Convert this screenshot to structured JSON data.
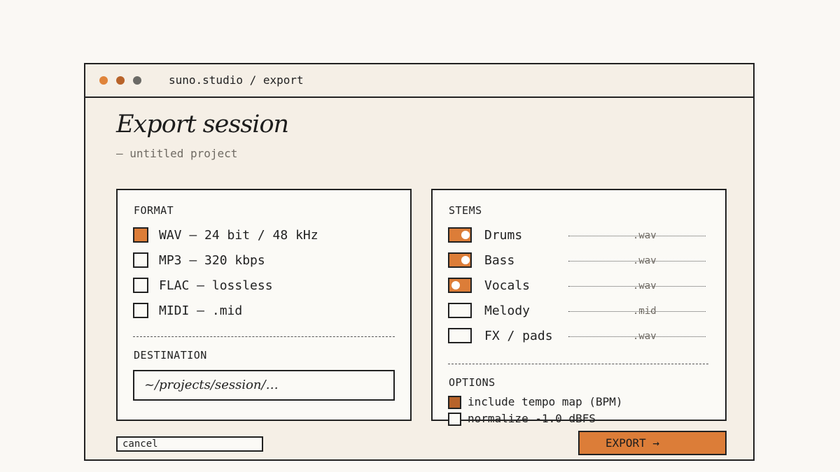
{
  "window": {
    "title": "suno.studio / export"
  },
  "header": {
    "title": "Export session",
    "subtitle": "— untitled project"
  },
  "format": {
    "label": "FORMAT",
    "options": [
      {
        "label": "WAV — 24 bit / 48 kHz",
        "checked": true
      },
      {
        "label": "MP3 — 320 kbps",
        "checked": false
      },
      {
        "label": "FLAC — lossless",
        "checked": false
      },
      {
        "label": "MIDI — .mid",
        "checked": false
      }
    ]
  },
  "destination": {
    "label": "DESTINATION",
    "value": "~/projects/session/…"
  },
  "stems": {
    "label": "STEMS",
    "items": [
      {
        "name": "Drums",
        "ext": ".wav",
        "on": true,
        "knob": "right"
      },
      {
        "name": "Bass",
        "ext": ".wav",
        "on": true,
        "knob": "right"
      },
      {
        "name": "Vocals",
        "ext": ".wav",
        "on": true,
        "knob": "left"
      },
      {
        "name": "Melody",
        "ext": ".mid",
        "on": false,
        "knob": "none"
      },
      {
        "name": "FX / pads",
        "ext": ".wav",
        "on": false,
        "knob": "none"
      }
    ]
  },
  "options": {
    "label": "OPTIONS",
    "items": [
      {
        "label": "include tempo map (BPM)",
        "checked": true
      },
      {
        "label": "normalize -1.0 dBFS",
        "checked": false
      }
    ]
  },
  "actions": {
    "cancel_label": "cancel",
    "export_label": "EXPORT →"
  },
  "colors": {
    "accent": "#dc7d38",
    "accent_dark": "#b8632a",
    "background": "#f5efe6"
  }
}
